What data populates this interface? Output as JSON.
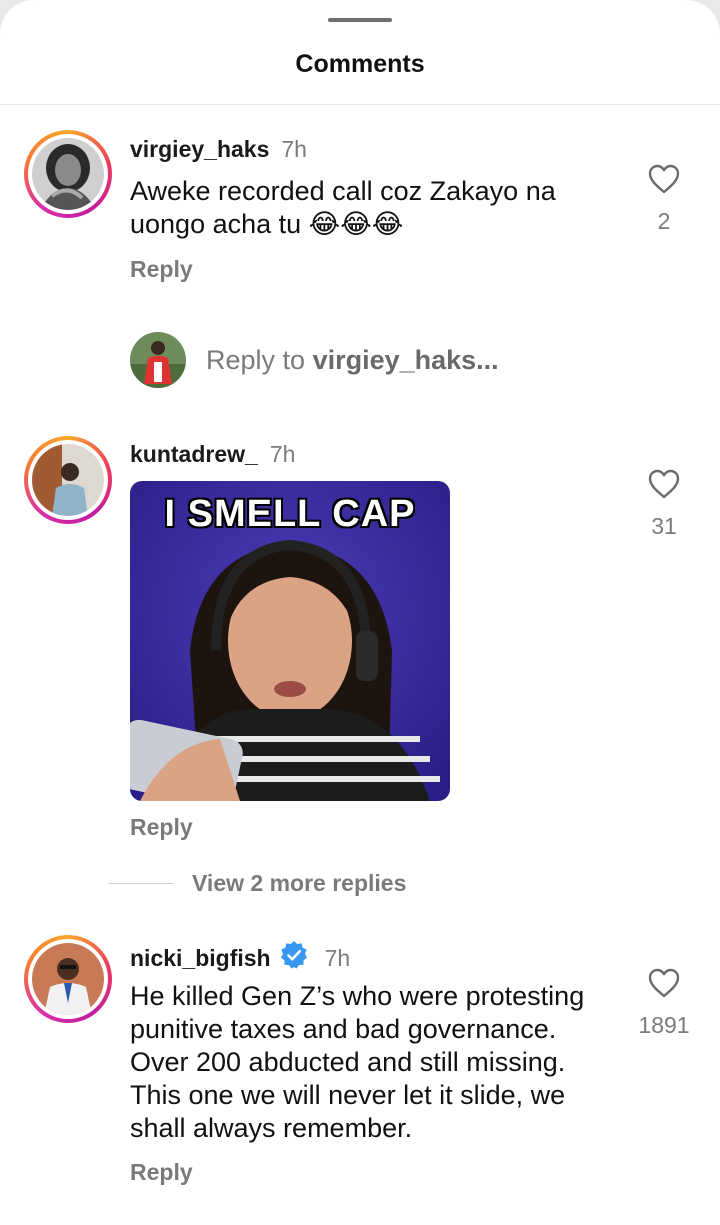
{
  "sheet": {
    "title": "Comments"
  },
  "comments": [
    {
      "username": "virgiey_haks",
      "time": "7h",
      "text": "Aweke recorded call coz Zakayo na uongo acha tu 😂😂😂",
      "likes": "2",
      "reply_label": "Reply"
    },
    {
      "username": "kuntadrew_",
      "time": "7h",
      "gif_caption": "I SMELL CAP",
      "likes": "31",
      "reply_label": "Reply",
      "view_more": "View 2 more replies"
    },
    {
      "username": "nicki_bigfish",
      "verified": true,
      "time": "7h",
      "text": "He killed Gen Z’s who were protesting punitive taxes and bad governance. Over 200 abducted and still missing. This one we will never let it slide, we shall always remember.",
      "likes": "1891",
      "reply_label": "Reply"
    }
  ],
  "reply_prompt": {
    "prefix": "Reply to ",
    "username": "virgiey_haks..."
  },
  "icons": {
    "like": "heart-outline-icon",
    "verified": "verified-badge-icon"
  },
  "colors": {
    "verified_blue": "#3897f0",
    "ring_gradient": [
      "#f9a72b",
      "#ef3c5c",
      "#c21c9f"
    ]
  }
}
